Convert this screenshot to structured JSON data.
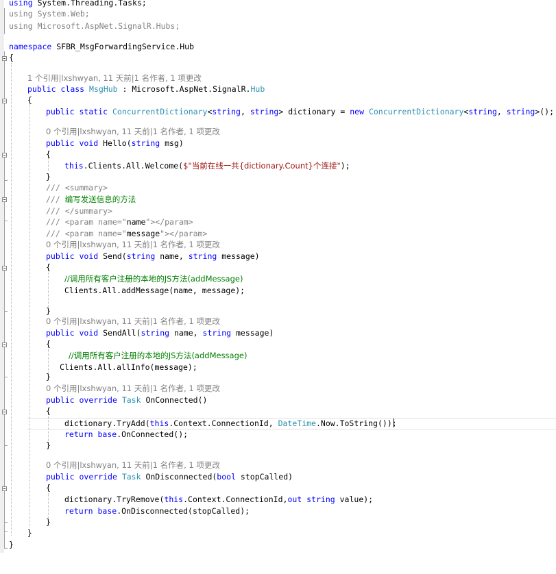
{
  "editor": {
    "using_keyword": "using",
    "usings": [
      "System.Threading.Tasks;",
      "System.Web;",
      "Microsoft.AspNet.SignalR.Hubs;"
    ],
    "namespace_keyword": "namespace",
    "namespace_name": "SFBR_MsgForwardingService.Hub",
    "lens_class": "1 个引用|lxshwyan, 11 天前|1 名作者, 1 项更改",
    "lens_method": "0 个引用|lxshwyan, 11 天前|1 名作者, 1 项更改",
    "class_decl": {
      "kw1": "public",
      "kw2": "class",
      "name": "MsgHub",
      "sep": " : Microsoft.AspNet.SignalR.",
      "base": "Hub"
    },
    "field_line": {
      "kw1": "public",
      "kw2": "static",
      "type": "ConcurrentDictionary",
      "gen": "<string, string>",
      "kw_string": "string",
      "rest1": " dictionary = ",
      "kw_new": "new",
      "end": "();"
    },
    "hello": {
      "kw1": "public",
      "kw2": "void",
      "name": " Hello(",
      "kw_string": "string",
      "param": " msg)",
      "body_this": "this",
      "body_mid": ".Clients.All.Welcome(",
      "body_str": "$\"当前在线一共{dictionary.Count}个连接\"",
      "body_end": ");"
    },
    "doc": {
      "l1": "/// <summary>",
      "l2_prefix": "/// ",
      "l2_text": "编写发送信息的方法",
      "l3": "/// </summary>",
      "l4_a": "/// <param name=\"",
      "l4_b": "name",
      "l4_c": "\"></param>",
      "l5_a": "/// <param name=\"",
      "l5_b": "message",
      "l5_c": "\"></param>"
    },
    "send": {
      "kw1": "public",
      "kw2": "void",
      "name": " Send(",
      "param1": " name, ",
      "param2": " message)",
      "comment": "//调用所有客户注册的本地的JS方法(addMessage)",
      "call": "Clients.All.addMessage(name, message);"
    },
    "sendall": {
      "name": " SendAll(",
      "comment": "//调用所有客户注册的本地的JS方法(addMessage)",
      "call": "Clients.All.allInfo(message);"
    },
    "onconnected": {
      "kw2": "override",
      "type": "Task",
      "name": " OnConnected()",
      "l1_a": "dictionary.TryAdd(",
      "l1_this": "this",
      "l1_b": ".Context.ConnectionId, ",
      "l1_type": "DateTime",
      "l1_c": ".Now.ToString());",
      "kw_return": "return",
      "kw_base": "base",
      "l2_b": ".OnConnected();"
    },
    "ondisconnected": {
      "name": " OnDisconnected(",
      "kw_bool": "bool",
      "param": " stopCalled)",
      "l1_a": "dictionary.TryRemove(",
      "l1_this": "this",
      "l1_b": ".Context.ConnectionId,",
      "kw_out": "out",
      "kw_string": "string",
      "l1_c": " value);",
      "l2_b": ".OnDisconnected(stopCalled);"
    },
    "open_brace": "{",
    "close_brace": "}"
  }
}
